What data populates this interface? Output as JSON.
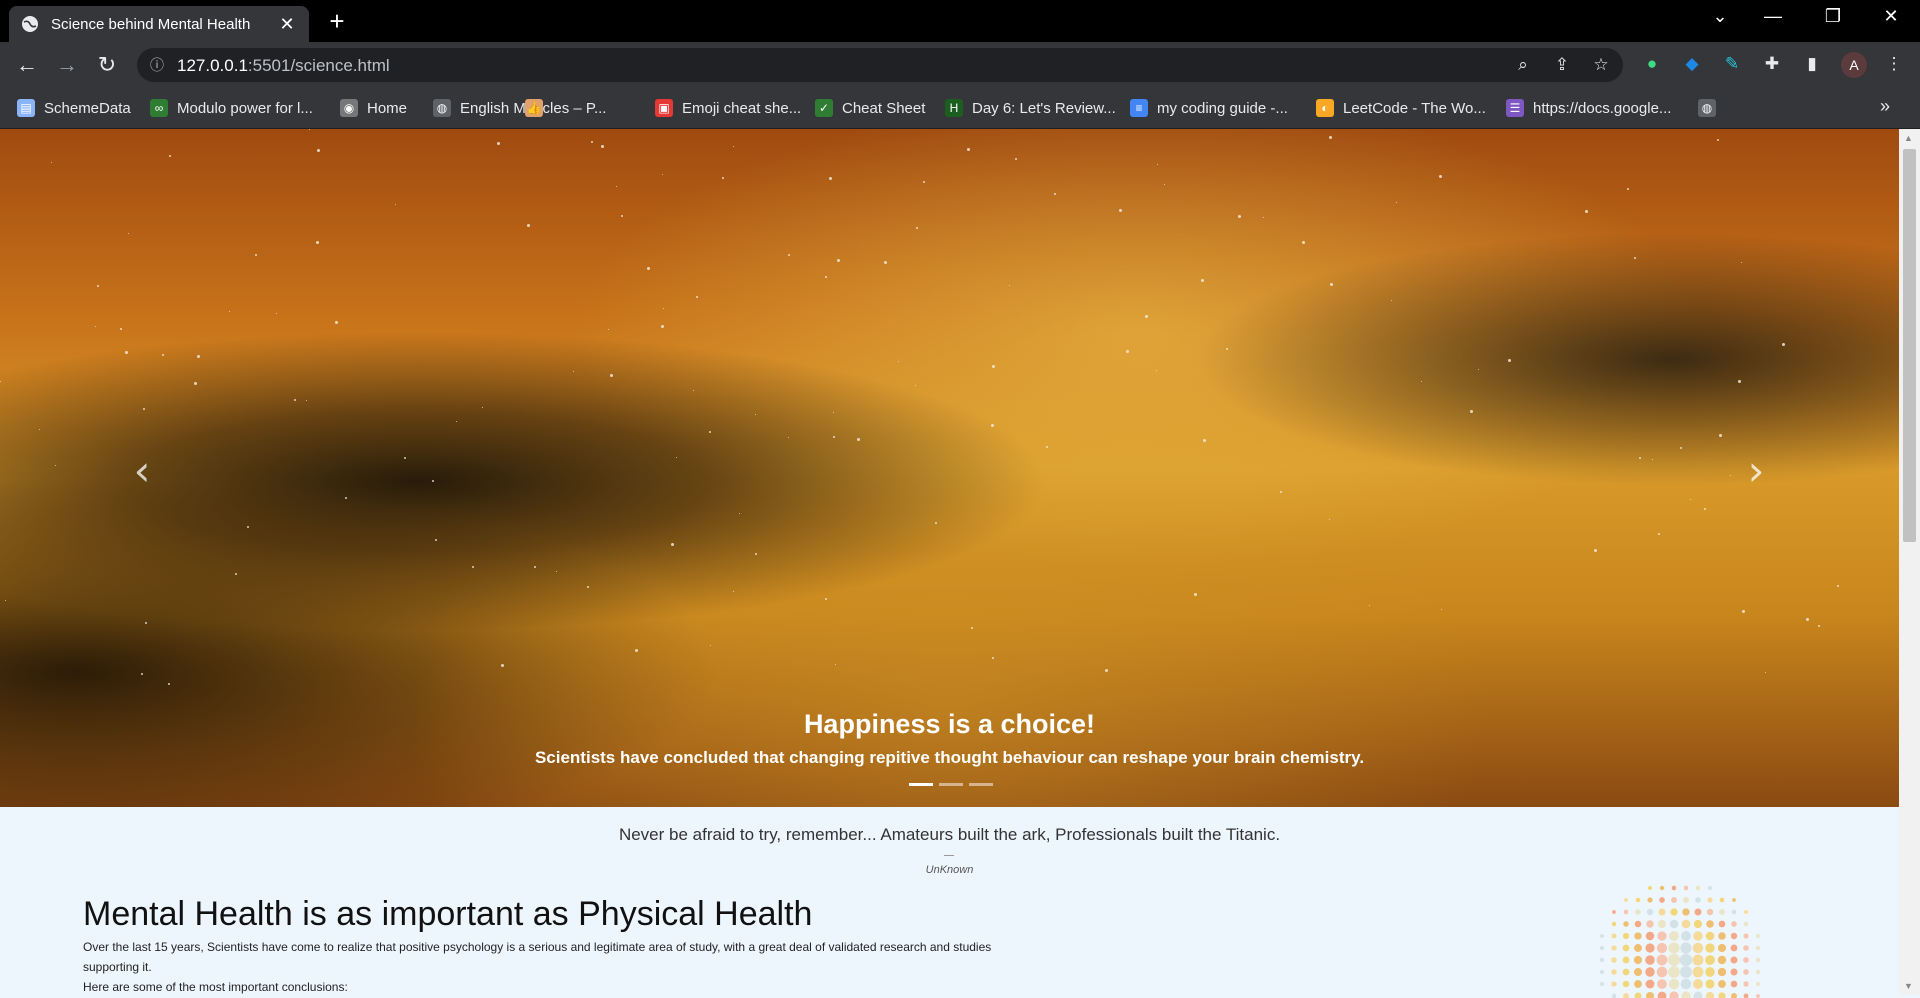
{
  "browser": {
    "tab_title": "Science behind Mental Health",
    "url_host": "127.0.0.1",
    "url_rest": ":5501/science.html",
    "avatar_letter": "A",
    "bookmarks": [
      {
        "label": "SchemeData",
        "icon": "page-icon",
        "color": "#8ab4f8"
      },
      {
        "label": "Modulo power for l...",
        "icon": "code-icon",
        "color": "#2e7d32"
      },
      {
        "label": "Home",
        "icon": "profile-icon",
        "color": "#777777"
      },
      {
        "label": "English Miracles – P...",
        "icon": "globe-icon",
        "color": "#5f6368"
      },
      {
        "label": "",
        "icon": "thumbs-up-icon",
        "color": "#e0a26a"
      },
      {
        "label": "Emoji cheat she...",
        "icon": "gift-icon",
        "color": "#e53935"
      },
      {
        "label": "Cheat Sheet",
        "icon": "check-icon",
        "color": "#2e7d32"
      },
      {
        "label": "Day 6: Let's Review...",
        "icon": "hackerrank-icon",
        "color": "#1b5e20"
      },
      {
        "label": "my coding guide -...",
        "icon": "docs-icon",
        "color": "#4285f4"
      },
      {
        "label": "LeetCode - The Wo...",
        "icon": "leetcode-icon",
        "color": "#f9a825"
      },
      {
        "label": "https://docs.google...",
        "icon": "forms-icon",
        "color": "#7e57c2"
      },
      {
        "label": "",
        "icon": "globe-icon",
        "color": "#5f6368"
      }
    ]
  },
  "carousel": {
    "title": "Happiness is a choice!",
    "text": "Scientists have concluded that changing repitive thought behaviour can reshape your brain chemistry.",
    "slide_count": 3,
    "active_slide": 1
  },
  "quote": {
    "text": "Never be afraid to try, remember... Amateurs built the ark, Professionals built the Titanic.",
    "author": "UnKnown"
  },
  "section": {
    "heading": "Mental Health is as important as Physical Health",
    "paragraph_1": "Over the last 15 years, Scientists have come to realize that positive psychology is a serious and legitimate area of study, with a great deal of validated research and studies supporting it.",
    "paragraph_2": "Here are some of the most important conclusions:"
  }
}
